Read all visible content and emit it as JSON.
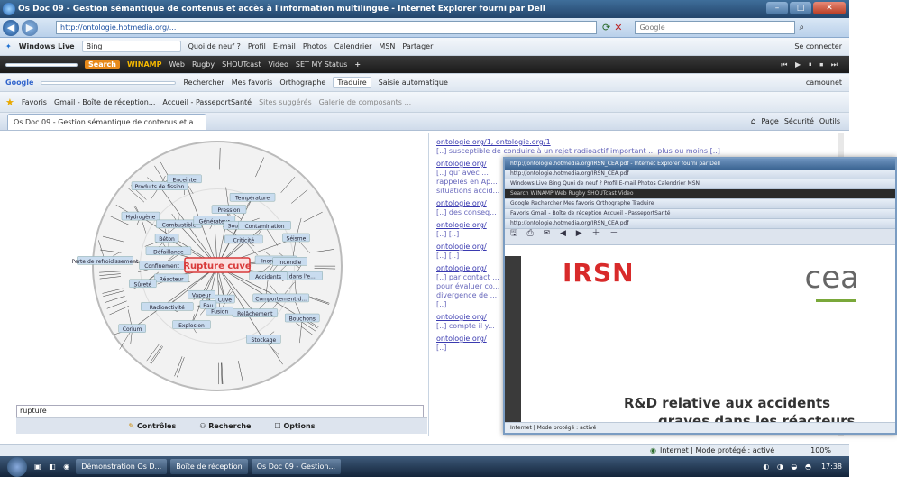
{
  "browser": {
    "title": "Os Doc 09 - Gestion sémantique de contenus et accès à l'information multilingue - Internet Explorer fourni par Dell",
    "address": "http://ontologie.hotmedia.org/...",
    "search_placeholder": "Google",
    "win_buttons": [
      "–",
      "□",
      "✕"
    ]
  },
  "toolbar_windowslive": {
    "brand": "Windows Live",
    "search": "Bing",
    "items": [
      "Quoi de neuf ?",
      "Profil",
      "E-mail",
      "Photos",
      "Calendrier",
      "MSN",
      "Partager"
    ],
    "signin": "Se connecter"
  },
  "toolbar_winamp": {
    "search_label": "Search",
    "brand": "WINAMP",
    "items": [
      "Web",
      "Rugby",
      "SHOUTcast",
      "Video",
      "SET MY Status"
    ]
  },
  "toolbar_google": {
    "brand": "Google",
    "items": [
      "Rechercher",
      "Mes favoris",
      "Orthographe",
      "Traduire",
      "Saisie automatique"
    ],
    "user": "camounet"
  },
  "favorites_bar": {
    "items": [
      "Favoris",
      "Gmail - Boîte de réception...",
      "Accueil - PasseportSanté",
      "Sites suggérés",
      "Galerie de composants ..."
    ]
  },
  "tab": {
    "label": "Os Doc 09 - Gestion sémantique de contenus et a..."
  },
  "command_bar": {
    "items": [
      "Page",
      "Sécurité",
      "Outils"
    ]
  },
  "graph": {
    "center_node": "Rupture cuve",
    "nodes": [
      "Rejet dans l'e...",
      "Accidents",
      "Comportement d...",
      "Bouchons",
      "Relâchement",
      "Stockage",
      "Cuve",
      "Fusion",
      "Eau",
      "Explosion",
      "Vapeur",
      "Corium",
      "Radioactivité",
      "Réacteur",
      "Sûreté",
      "Confinement",
      "Perte de refroidissement",
      "Défaillance",
      "Béton",
      "Hydrogène",
      "Combustible",
      "Produits de fission",
      "Enceinte",
      "Générateur",
      "Pression",
      "Température",
      "Sources",
      "Criticité",
      "Contamination",
      "Séisme",
      "Inondation",
      "Incendie"
    ],
    "search_value": "rupture",
    "controls": [
      "Contrôles",
      "Recherche",
      "Options"
    ]
  },
  "results": {
    "items": [
      {
        "link": "ontologie.org/1, ontologie.org/1",
        "snippet": "[..] susceptible de conduire à un rejet radioactif important ... plus ou moins [..]"
      },
      {
        "link": "ontologie.org/",
        "snippet": "[..] qu' avec ..."
      },
      {
        "link": "",
        "snippet": "rappelés en Ap..."
      },
      {
        "link": "",
        "snippet": "situations accid..."
      },
      {
        "link": "ontologie.org/",
        "snippet": "[..] des conseq..."
      },
      {
        "link": "ontologie.org/",
        "snippet": "[..] [..]"
      },
      {
        "link": "ontologie.org/",
        "snippet": "[..] [..]"
      },
      {
        "link": "ontologie.org/",
        "snippet": "[..] par contact ..."
      },
      {
        "link": "",
        "snippet": "pour évaluer co..."
      },
      {
        "link": "",
        "snippet": "divergence de ..."
      },
      {
        "link": "",
        "snippet": "[..]"
      },
      {
        "link": "ontologie.org/",
        "snippet": "[..] compte il y..."
      },
      {
        "link": "ontologie.org/",
        "snippet": "[..]"
      }
    ]
  },
  "popup": {
    "title": "http://ontologie.hotmedia.org/IRSN_CEA.pdf - Internet Explorer fourni par Dell",
    "rows": [
      "http://ontologie.hotmedia.org/IRSN_CEA.pdf",
      "Windows Live  Bing  Quoi de neuf ?  Profil  E-mail  Photos  Calendrier  MSN",
      "Search  WINAMP  Web  Rugby  SHOUTcast  Video",
      "Google  Rechercher  Mes favoris  Orthographe  Traduire",
      "Favoris  Gmail - Boîte de réception  Accueil - PasseportSanté",
      "http://ontologie.hotmedia.org/IRSN_CEA.pdf"
    ],
    "irsn": "IRSN",
    "cea": "cea",
    "pdf_title": "R&D relative aux accidents",
    "pdf_subtitle": "graves dans les réacteurs",
    "status": "Internet | Mode protégé : activé"
  },
  "status_bar": {
    "zone": "Internet | Mode protégé : activé",
    "zoom": "100%"
  },
  "taskbar": {
    "tasks": [
      "Démonstration Os D...",
      "Boîte de réception",
      "Os Doc 09 - Gestion..."
    ],
    "clock": "17:38"
  },
  "colors": {
    "accent": "#2a5a96",
    "center_node": "#d83a3a",
    "node_fill": "#c9dcef"
  }
}
